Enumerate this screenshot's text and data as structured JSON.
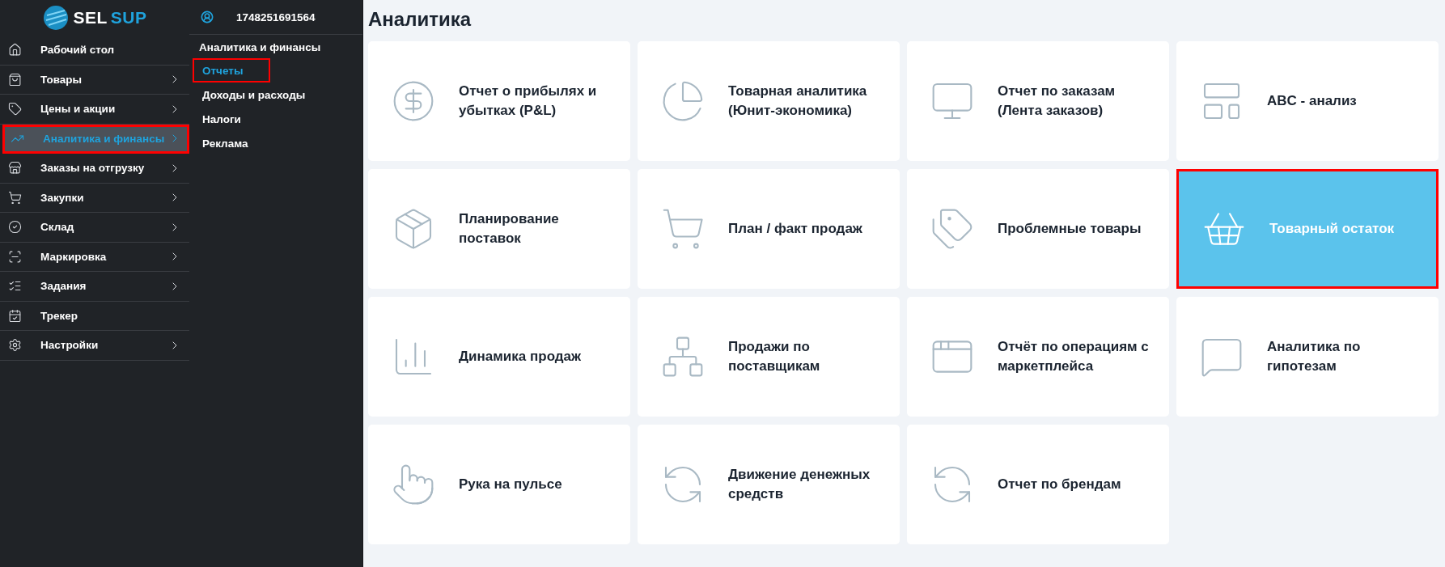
{
  "logo": {
    "first": "SEL",
    "second": "SUP"
  },
  "sidebar": {
    "items": [
      {
        "kind": "link",
        "label": "Рабочий стол",
        "selected": false,
        "highlighted": false
      },
      {
        "kind": "group",
        "label": "Товары",
        "selected": false,
        "highlighted": false
      },
      {
        "kind": "group",
        "label": "Цены и акции",
        "selected": false,
        "highlighted": false
      },
      {
        "kind": "group",
        "label": "Аналитика и финансы",
        "selected": true,
        "highlighted": true
      },
      {
        "kind": "group",
        "label": "Заказы на отгрузку",
        "selected": false,
        "highlighted": false
      },
      {
        "kind": "group",
        "label": "Закупки",
        "selected": false,
        "highlighted": false
      },
      {
        "kind": "group",
        "label": "Склад",
        "selected": false,
        "highlighted": false
      },
      {
        "kind": "group",
        "label": "Маркировка",
        "selected": false,
        "highlighted": false
      },
      {
        "kind": "group",
        "label": "Задания",
        "selected": false,
        "highlighted": false
      },
      {
        "kind": "link",
        "label": "Трекер",
        "selected": false,
        "highlighted": false
      },
      {
        "kind": "group",
        "label": "Настройки",
        "selected": false,
        "highlighted": false
      }
    ]
  },
  "submenu": {
    "user": "1748251691564",
    "heading": "Аналитика и финансы",
    "items": [
      {
        "label": "Отчеты",
        "selected": true,
        "highlighted": true
      },
      {
        "label": "Доходы и расходы",
        "selected": false,
        "highlighted": false
      },
      {
        "label": "Налоги",
        "selected": false,
        "highlighted": false
      },
      {
        "label": "Реклама",
        "selected": false,
        "highlighted": false
      }
    ]
  },
  "page": {
    "title": "Аналитика",
    "cards": [
      {
        "label": "Отчет о прибылях и убытках (P&L)",
        "selected": false,
        "highlighted": false
      },
      {
        "label": "Товарная аналитика (Юнит-экономика)",
        "selected": false,
        "highlighted": false
      },
      {
        "label": "Отчет по заказам (Лента заказов)",
        "selected": false,
        "highlighted": false
      },
      {
        "label": "ABC - анализ",
        "selected": false,
        "highlighted": false
      },
      {
        "label": "Планирование поставок",
        "selected": false,
        "highlighted": false
      },
      {
        "label": "План / факт продаж",
        "selected": false,
        "highlighted": false
      },
      {
        "label": "Проблемные товары",
        "selected": false,
        "highlighted": false
      },
      {
        "label": "Товарный остаток",
        "selected": true,
        "highlighted": true
      },
      {
        "label": "Динамика продаж",
        "selected": false,
        "highlighted": false
      },
      {
        "label": "Продажи по поставщикам",
        "selected": false,
        "highlighted": false
      },
      {
        "label": "Отчёт по операциям с маркетплейса",
        "selected": false,
        "highlighted": false
      },
      {
        "label": "Аналитика по гипотезам",
        "selected": false,
        "highlighted": false
      },
      {
        "label": "Рука на пульсе",
        "selected": false,
        "highlighted": false
      },
      {
        "label": "Движение денежных средств",
        "selected": false,
        "highlighted": false
      },
      {
        "label": "Отчет по брендам",
        "selected": false,
        "highlighted": false
      }
    ]
  }
}
